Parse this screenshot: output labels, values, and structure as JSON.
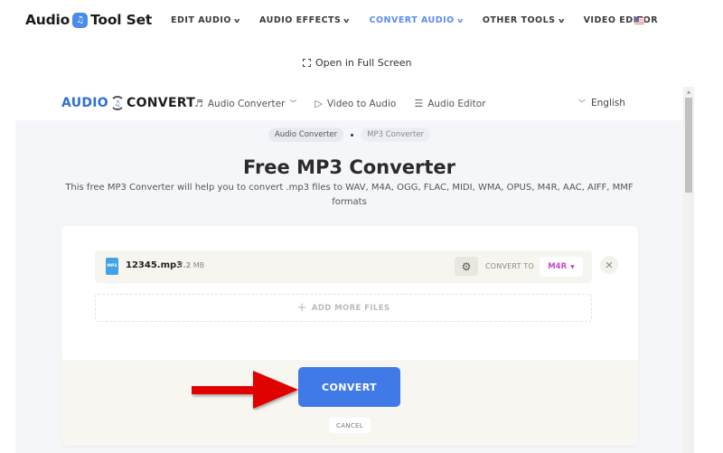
{
  "site": {
    "brand_left": "Audio",
    "brand_right": "Tool Set",
    "menu": [
      {
        "label": "EDIT AUDIO",
        "active": false
      },
      {
        "label": "AUDIO EFFECTS",
        "active": false
      },
      {
        "label": "CONVERT AUDIO",
        "active": true
      },
      {
        "label": "OTHER TOOLS",
        "active": false
      },
      {
        "label": "VIDEO EDITOR",
        "active": false
      }
    ],
    "language_flag": "us-flag-icon",
    "fullscreen_label": "Open in Full Screen"
  },
  "app": {
    "logo_left": "AUDIO",
    "logo_right": "CONVERT",
    "nav": [
      {
        "label": "Audio Converter",
        "icon": "music-note-icon",
        "has_dropdown": true
      },
      {
        "label": "Video to Audio",
        "icon": "play-box-icon",
        "has_dropdown": false
      },
      {
        "label": "Audio Editor",
        "icon": "sliders-icon",
        "has_dropdown": false
      }
    ],
    "language": "English",
    "breadcrumbs": [
      "Audio Converter",
      "MP3 Converter"
    ],
    "title": "Free MP3 Converter",
    "subtitle": "This free MP3 Converter will help you to convert .mp3 files to WAV, M4A, OGG, FLAC, MIDI, WMA, OPUS, M4R, AAC, AIFF, MMF formats",
    "file": {
      "type_badge": "MP3",
      "name": "12345.mp3",
      "size_value": "7.2",
      "size_unit": "MB",
      "convert_to_label": "CONVERT TO",
      "format": "M4R"
    },
    "add_more_label": "ADD MORE FILES",
    "convert_label": "CONVERT",
    "cancel_label": "CANCEL",
    "colors": {
      "accent": "#3f7ae6",
      "active_menu": "#5b8def",
      "format_text": "#c848c8",
      "arrow": "#e00000"
    }
  }
}
